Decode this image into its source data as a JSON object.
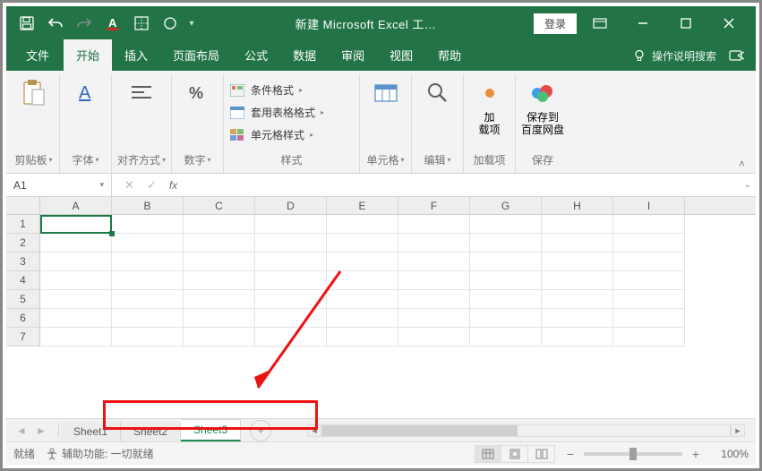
{
  "title": "新建 Microsoft Excel 工…",
  "login": "登录",
  "ribbon_tabs": {
    "file": "文件",
    "home": "开始",
    "insert": "插入",
    "layout": "页面布局",
    "formulas": "公式",
    "data": "数据",
    "review": "审阅",
    "view": "视图",
    "help": "帮助",
    "tell_me": "操作说明搜索"
  },
  "ribbon_groups": {
    "clipboard": "剪贴板",
    "font": "字体",
    "align": "对齐方式",
    "number": "数字",
    "styles": "样式",
    "cells": "单元格",
    "editing": "编辑",
    "addins_big": "加\n载项",
    "addins_label": "加载项",
    "save_big": "保存到\n百度网盘",
    "save_label": "保存",
    "cond_format": "条件格式",
    "table_format": "套用表格格式",
    "cell_styles": "单元格样式"
  },
  "name_box": "A1",
  "columns": [
    "A",
    "B",
    "C",
    "D",
    "E",
    "F",
    "G",
    "H",
    "I"
  ],
  "rows": [
    "1",
    "2",
    "3",
    "4",
    "5",
    "6",
    "7"
  ],
  "sheet_tabs": {
    "s1": "Sheet1",
    "s2": "Sheet2",
    "s3": "Sheet3"
  },
  "status": {
    "ready": "就绪",
    "accessibility": "辅助功能: 一切就绪",
    "zoom": "100%"
  }
}
